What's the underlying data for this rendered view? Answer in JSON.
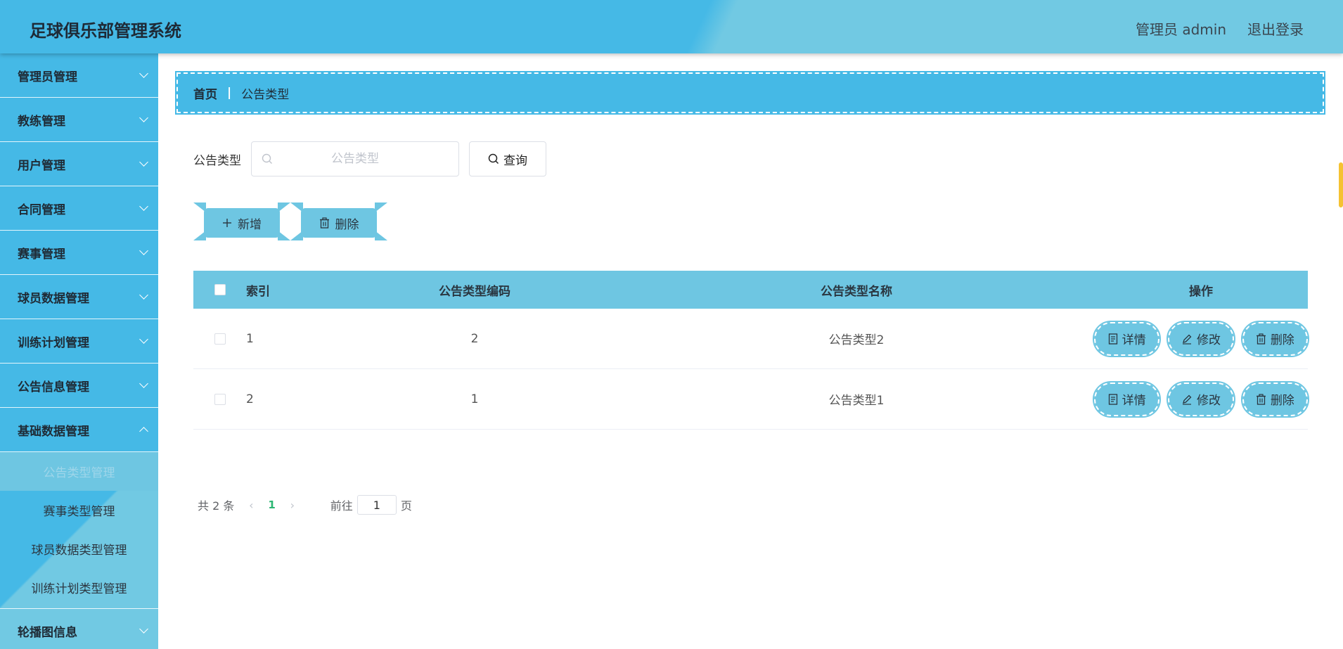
{
  "header": {
    "title": "足球俱乐部管理系统",
    "user": "管理员 admin",
    "logout": "退出登录"
  },
  "sidebar": {
    "items": [
      {
        "label": "管理员管理"
      },
      {
        "label": "教练管理"
      },
      {
        "label": "用户管理"
      },
      {
        "label": "合同管理"
      },
      {
        "label": "赛事管理"
      },
      {
        "label": "球员数据管理"
      },
      {
        "label": "训练计划管理"
      },
      {
        "label": "公告信息管理"
      },
      {
        "label": "基础数据管理"
      }
    ],
    "submenu": [
      {
        "label": "公告类型管理"
      },
      {
        "label": "赛事类型管理"
      },
      {
        "label": "球员数据类型管理"
      },
      {
        "label": "训练计划类型管理"
      }
    ],
    "last": {
      "label": "轮播图信息"
    }
  },
  "breadcrumb": {
    "home": "首页",
    "sep": "|",
    "current": "公告类型"
  },
  "search": {
    "label": "公告类型",
    "placeholder": "公告类型",
    "button": "查询"
  },
  "actions": {
    "add": "新增",
    "delete": "删除"
  },
  "table": {
    "columns": [
      "索引",
      "公告类型编码",
      "公告类型名称",
      "操作"
    ],
    "rows": [
      {
        "index": "1",
        "code": "2",
        "name": "公告类型2"
      },
      {
        "index": "2",
        "code": "1",
        "name": "公告类型1"
      }
    ],
    "ops": {
      "detail": "详情",
      "edit": "修改",
      "delete": "删除"
    }
  },
  "pager": {
    "total": "共 2 条",
    "page": "1",
    "goto": "前往",
    "jump_value": "1",
    "unit": "页"
  },
  "colors": {
    "primary": "#45b9e6",
    "light": "#6ec6e2",
    "active_page": "#2bb673"
  }
}
